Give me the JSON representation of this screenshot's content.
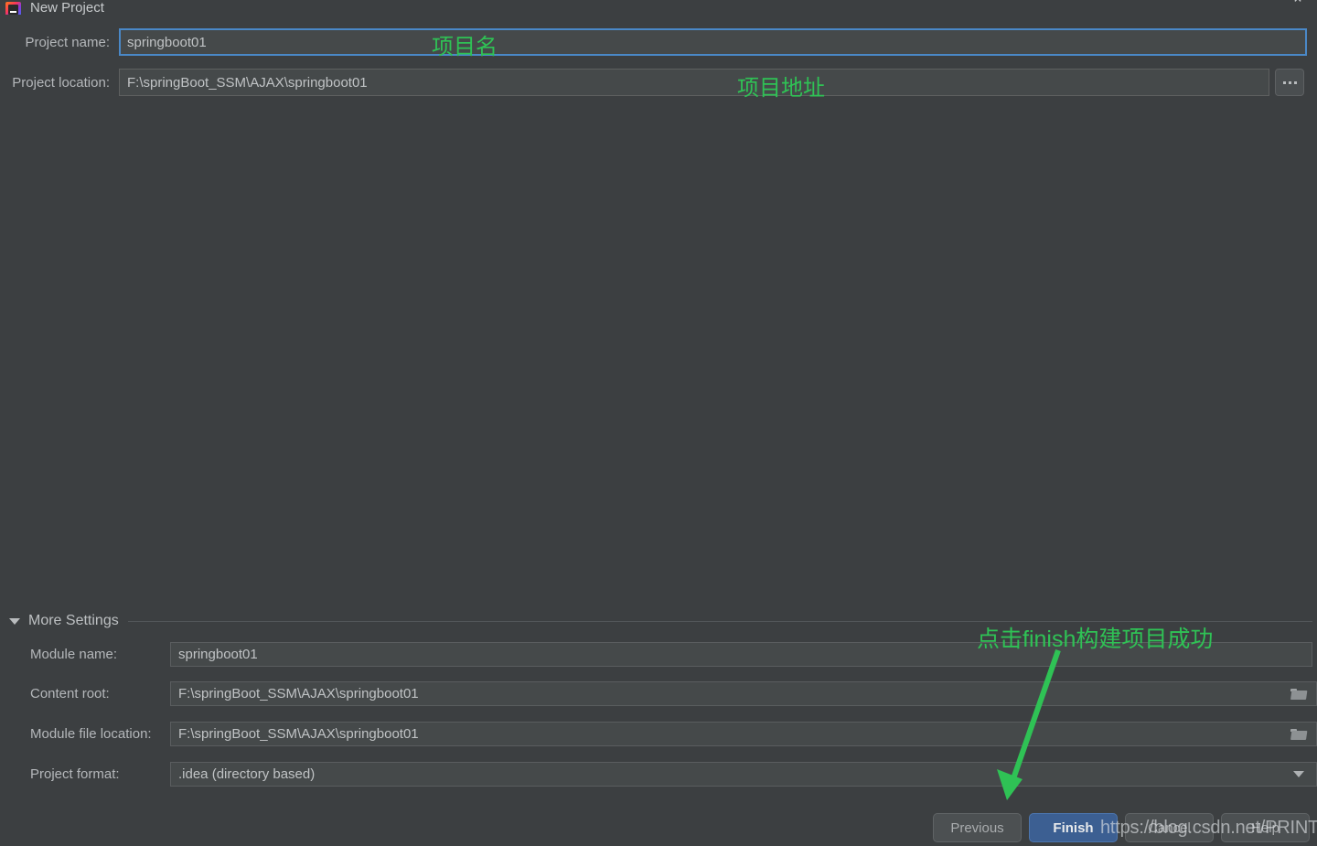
{
  "window": {
    "title": "New Project",
    "icon": "intellij-idea-logo",
    "close_label": "⌃"
  },
  "form": {
    "project_name": {
      "label": "Project name:",
      "value": "springboot01",
      "focused": true
    },
    "project_location": {
      "label": "Project location:",
      "value": "F:\\springBoot_SSM\\AJAX\\springboot01",
      "browse_label": "..."
    }
  },
  "more_settings": {
    "label": "More Settings",
    "expanded": true,
    "fields": [
      {
        "label": "Module name:",
        "value": "springboot01",
        "trailing": "none"
      },
      {
        "label": "Content root:",
        "value": "F:\\springBoot_SSM\\AJAX\\springboot01",
        "trailing": "folder"
      },
      {
        "label": "Module file location:",
        "value": "F:\\springBoot_SSM\\AJAX\\springboot01",
        "trailing": "folder"
      },
      {
        "label": "Project format:",
        "value": ".idea (directory based)",
        "trailing": "dropdown"
      }
    ]
  },
  "buttons": {
    "previous": "Previous",
    "finish": "Finish",
    "cancel": "Cancel",
    "help": "Help"
  },
  "annotations": {
    "project_name": "项目名",
    "project_location": "项目地址",
    "finish": "点击finish构建项目成功",
    "color": "#2fc255"
  },
  "watermark": {
    "text": "https://blog.csdn.net/PRINTFdfjc"
  },
  "theme": {
    "background": "#3c3f41",
    "field_background": "#45494a",
    "focus_border": "#4a88c7",
    "primary_button": "#3c5f92"
  }
}
